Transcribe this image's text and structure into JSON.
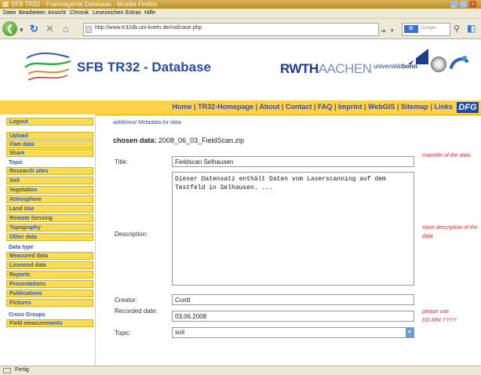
{
  "window": {
    "title": "SFB TR32 - Frameagents Database - Mozilla Firefox",
    "controls": [
      "_",
      "□",
      "×"
    ]
  },
  "menu": [
    "Datei",
    "Bearbeiten",
    "Ansicht",
    "Chronik",
    "Lesezeichen",
    "Extras",
    "Hilfe"
  ],
  "toolbar": {
    "url": "http://www.tr32db.uni-koeln.de/md/case.php",
    "search_engine": "G",
    "search_placeholder": "Google"
  },
  "header": {
    "site_title": "SFB TR32 - Database",
    "rwth_bold": "RWTH",
    "rwth_light": "AACHEN",
    "bonn_prefix": "universität",
    "bonn_bold": "bonn"
  },
  "topnav": {
    "links": [
      "Home",
      "TR32-Homepage",
      "About",
      "Contact",
      "FAQ",
      "Imprint",
      "WebGIS",
      "Sitemap",
      "Links"
    ],
    "dfg": "DFG"
  },
  "sidebar": {
    "logout": "Logout",
    "upload": "Upload",
    "own_data": "Own data",
    "share": "Share",
    "topic_header": "Topic",
    "topic_items": [
      "Research sites",
      "Soil",
      "Vegetation",
      "Atmosphere",
      "Land Use",
      "Remote Sensing",
      "Topography",
      "Other data"
    ],
    "datatype_header": "Data type",
    "datatype_items": [
      "Measured data",
      "Licenced data",
      "Reports",
      "Presentations",
      "Publications",
      "Pictures"
    ],
    "cross_header": "Cross Groups",
    "cross_items": [
      "Field measurements"
    ]
  },
  "main": {
    "subheading": "additional Metadata for data",
    "chosen_label": "chosen data:",
    "chosen_value": "2008_06_03_FieldScan.zip",
    "fields": {
      "title_label": "Title:",
      "title_value": "Fieldscan Selhausen",
      "title_hint": "maintitle of the data",
      "description_label": "Description:",
      "description_value": "Dieser Datensatz enthält Daten vom Laserscanning auf dem Testfeld in Selhausen. ...",
      "description_hint": "short description of the data",
      "creator_label": "Creator:",
      "creator_value": "Curdt",
      "recorded_label": "Recorded date:",
      "recorded_value": "03.06.2008",
      "recorded_hint": "please use DD.MM.YYYY",
      "topic_label": "Topic:",
      "topic_value": "soil"
    }
  },
  "status": {
    "text": "Fertig"
  }
}
